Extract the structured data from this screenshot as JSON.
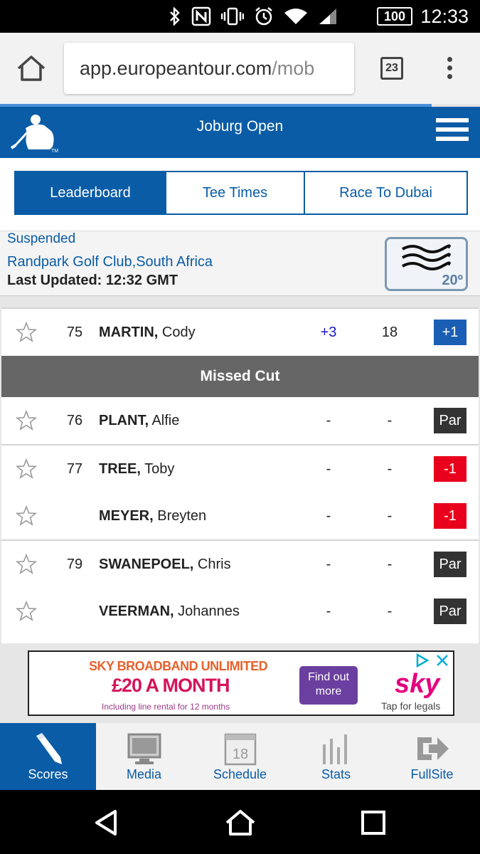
{
  "status_bar": {
    "time": "12:33",
    "battery": "100",
    "icons": [
      "bluetooth-icon",
      "nfc-icon",
      "vibrate-icon",
      "alarm-icon",
      "wifi-icon",
      "signal-icon"
    ]
  },
  "browser": {
    "url_host": "app.europeantour.com",
    "url_path": "/mob",
    "tab_count": "23"
  },
  "header": {
    "title": "Joburg Open"
  },
  "tabs": [
    {
      "label": "Leaderboard",
      "active": true
    },
    {
      "label": "Tee Times",
      "active": false
    },
    {
      "label": "Race To Dubai",
      "active": false
    }
  ],
  "info": {
    "status": "Suspended",
    "course": "Randpark Golf Club,South Africa",
    "updated": "Last Updated: 12:32 GMT",
    "temperature": "20º"
  },
  "leaderboard": {
    "rows_top": [
      {
        "pos": "75",
        "last": "MARTIN,",
        "first": "Cody",
        "to_par": "+3",
        "thru": "18",
        "today": "+1",
        "today_style": "blue"
      }
    ],
    "missed_cut_label": "Missed Cut",
    "rows_missed": [
      {
        "pos": "76",
        "last": "PLANT,",
        "first": "Alfie",
        "to_par": "-",
        "thru": "-",
        "today": "Par",
        "today_style": "dark"
      },
      {
        "pos": "77",
        "last": "TREE,",
        "first": "Toby",
        "to_par": "-",
        "thru": "-",
        "today": "-1",
        "today_style": "red"
      },
      {
        "pos": "",
        "last": "MEYER,",
        "first": "Breyten",
        "to_par": "-",
        "thru": "-",
        "today": "-1",
        "today_style": "red"
      },
      {
        "pos": "79",
        "last": "SWANEPOEL,",
        "first": "Chris",
        "to_par": "-",
        "thru": "-",
        "today": "Par",
        "today_style": "dark"
      },
      {
        "pos": "",
        "last": "VEERMAN,",
        "first": "Johannes",
        "to_par": "-",
        "thru": "-",
        "today": "Par",
        "today_style": "dark"
      }
    ]
  },
  "ad": {
    "line1": "SKY BROADBAND UNLIMITED",
    "line2": "£20 A MONTH",
    "line3": "Including line rental for 12 months",
    "cta": "Find out more",
    "brand": "sky",
    "legal": "Tap for legals"
  },
  "bottom_nav": [
    {
      "label": "Scores",
      "icon": "pencil-icon",
      "active": true
    },
    {
      "label": "Media",
      "icon": "monitor-icon",
      "active": false
    },
    {
      "label": "Schedule",
      "icon": "calendar-icon",
      "calendar_day": "18",
      "active": false
    },
    {
      "label": "Stats",
      "icon": "bar-stats-icon",
      "active": false
    },
    {
      "label": "FullSite",
      "icon": "exit-arrow-icon",
      "active": false
    }
  ],
  "colors": {
    "brand_blue": "#0a5ca6",
    "red_score": "#e8001c",
    "dark_score": "#333333",
    "blue_score": "#1a5fb4"
  }
}
